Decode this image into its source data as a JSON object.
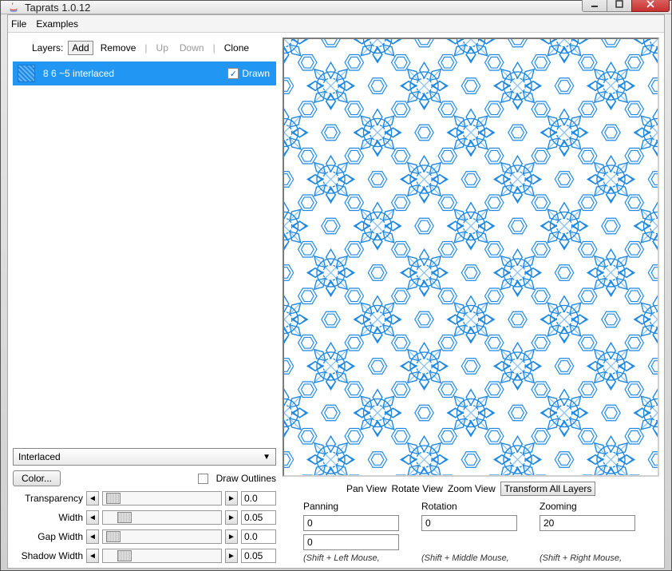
{
  "window": {
    "title": "Taprats 1.0.12"
  },
  "menubar": {
    "file": "File",
    "examples": "Examples"
  },
  "layers_toolbar": {
    "label": "Layers:",
    "add": "Add",
    "remove": "Remove",
    "up": "Up",
    "down": "Down",
    "clone": "Clone"
  },
  "layer": {
    "name": "8 6 ~5 interlaced",
    "drawn_label": "Drawn"
  },
  "style_dropdown": {
    "selected": "Interlaced"
  },
  "color_button": "Color...",
  "draw_outlines_label": "Draw Outlines",
  "sliders": [
    {
      "label": "Transparency",
      "value": "0.0"
    },
    {
      "label": "Width",
      "value": "0.05"
    },
    {
      "label": "Gap Width",
      "value": "0.0"
    },
    {
      "label": "Shadow Width",
      "value": "0.05"
    }
  ],
  "view_toolbar": {
    "pan": "Pan View",
    "rotate": "Rotate View",
    "zoom": "Zoom View",
    "transform_all": "Transform All Layers"
  },
  "transform": {
    "panning_label": "Panning",
    "rotation_label": "Rotation",
    "zooming_label": "Zooming",
    "pan_x": "0",
    "pan_y": "0",
    "rotation": "0",
    "zoom": "20"
  },
  "hints": {
    "pan": "(Shift + Left Mouse,",
    "rot": "(Shift + Middle Mouse,",
    "zoom": "(Shift + Right Mouse,"
  }
}
